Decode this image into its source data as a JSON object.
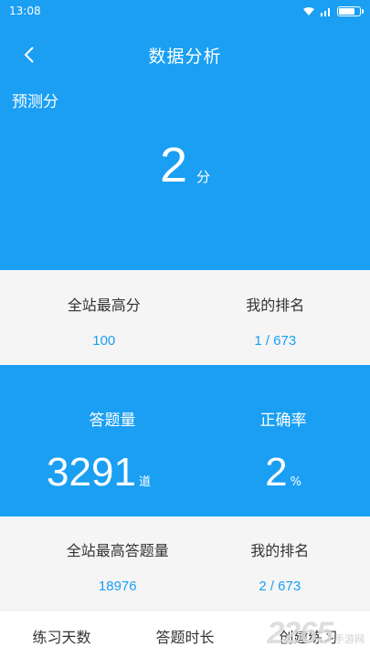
{
  "status_bar": {
    "time": "13:08"
  },
  "nav": {
    "title": "数据分析"
  },
  "predicted": {
    "label": "预测分",
    "value": "2",
    "unit": "分"
  },
  "score_stats": {
    "site_high_label": "全站最高分",
    "site_high_value": "100",
    "my_rank_label": "我的排名",
    "my_rank_value": "1 / 673"
  },
  "answer_stats": {
    "count_label": "答题量",
    "count_value": "3291",
    "count_unit": "道",
    "accuracy_label": "正确率",
    "accuracy_value": "2",
    "accuracy_unit": "%"
  },
  "answer_rank_stats": {
    "site_high_label": "全站最高答题量",
    "site_high_value": "18976",
    "my_rank_label": "我的排名",
    "my_rank_value": "2 / 673"
  },
  "bottom_tabs": [
    "练习天数",
    "答题时长",
    "创建练习"
  ],
  "watermark": {
    "number": "2265",
    "text": "手游网"
  },
  "colors": {
    "primary": "#1a9ff3",
    "gray_bg": "#f5f5f5"
  }
}
